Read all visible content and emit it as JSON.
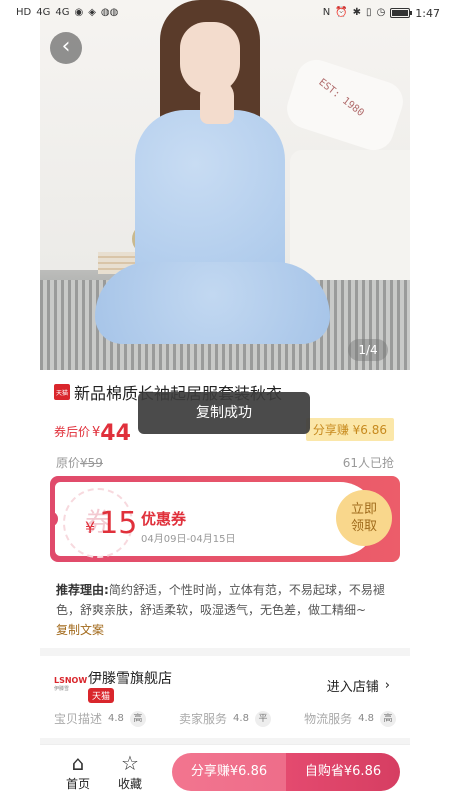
{
  "status_bar": {
    "left_icons": [
      "HD",
      "4G",
      "4G",
      "wifi",
      "shield",
      "apps"
    ],
    "time": "1:47",
    "battery_level": 0.85
  },
  "hero": {
    "pillow_text": "EST: 1980",
    "page_indicator": "1/4"
  },
  "product": {
    "title": "新品棉质长袖起居服套装秋衣",
    "badge_label": "天猫",
    "after_coupon_label": "券后价",
    "currency": "¥",
    "price": "44",
    "share_earn": "分享赚 ¥6.86",
    "original_price_label": "原价",
    "original_price": "¥59",
    "sold_count": "61人已抢"
  },
  "toast": {
    "text": "复制成功"
  },
  "coupon": {
    "watermark": "券",
    "currency": "¥",
    "amount": "15",
    "name": "优惠券",
    "date_range": "04月09日-04月15日",
    "claim_label": "立即领取"
  },
  "recommend": {
    "label": "推荐理由:",
    "text": "简约舒适，个性时尚，立体有范，不易起球，不易褪色，舒爽亲肤，舒适柔软，吸湿透气，无色差，做工精细~",
    "copy_label": "复制文案"
  },
  "shop": {
    "logo_text": "LSNOW",
    "logo_sub": "伊滕雪",
    "name": "伊滕雪旗舰店",
    "tag": "天猫",
    "enter_label": "进入店铺",
    "ratings": [
      {
        "label": "宝贝描述",
        "score": "4.8",
        "level": "高"
      },
      {
        "label": "卖家服务",
        "score": "4.8",
        "level": "平"
      },
      {
        "label": "物流服务",
        "score": "4.8",
        "level": "高"
      }
    ]
  },
  "bottom_bar": {
    "home_label": "首页",
    "favorite_label": "收藏",
    "share_button": "分享赚¥6.86",
    "buy_button": "自购省¥6.86"
  },
  "colors": {
    "accent_red": "#e0303b",
    "coupon_pink": "#e04a6b",
    "gold": "#f9d78c"
  }
}
